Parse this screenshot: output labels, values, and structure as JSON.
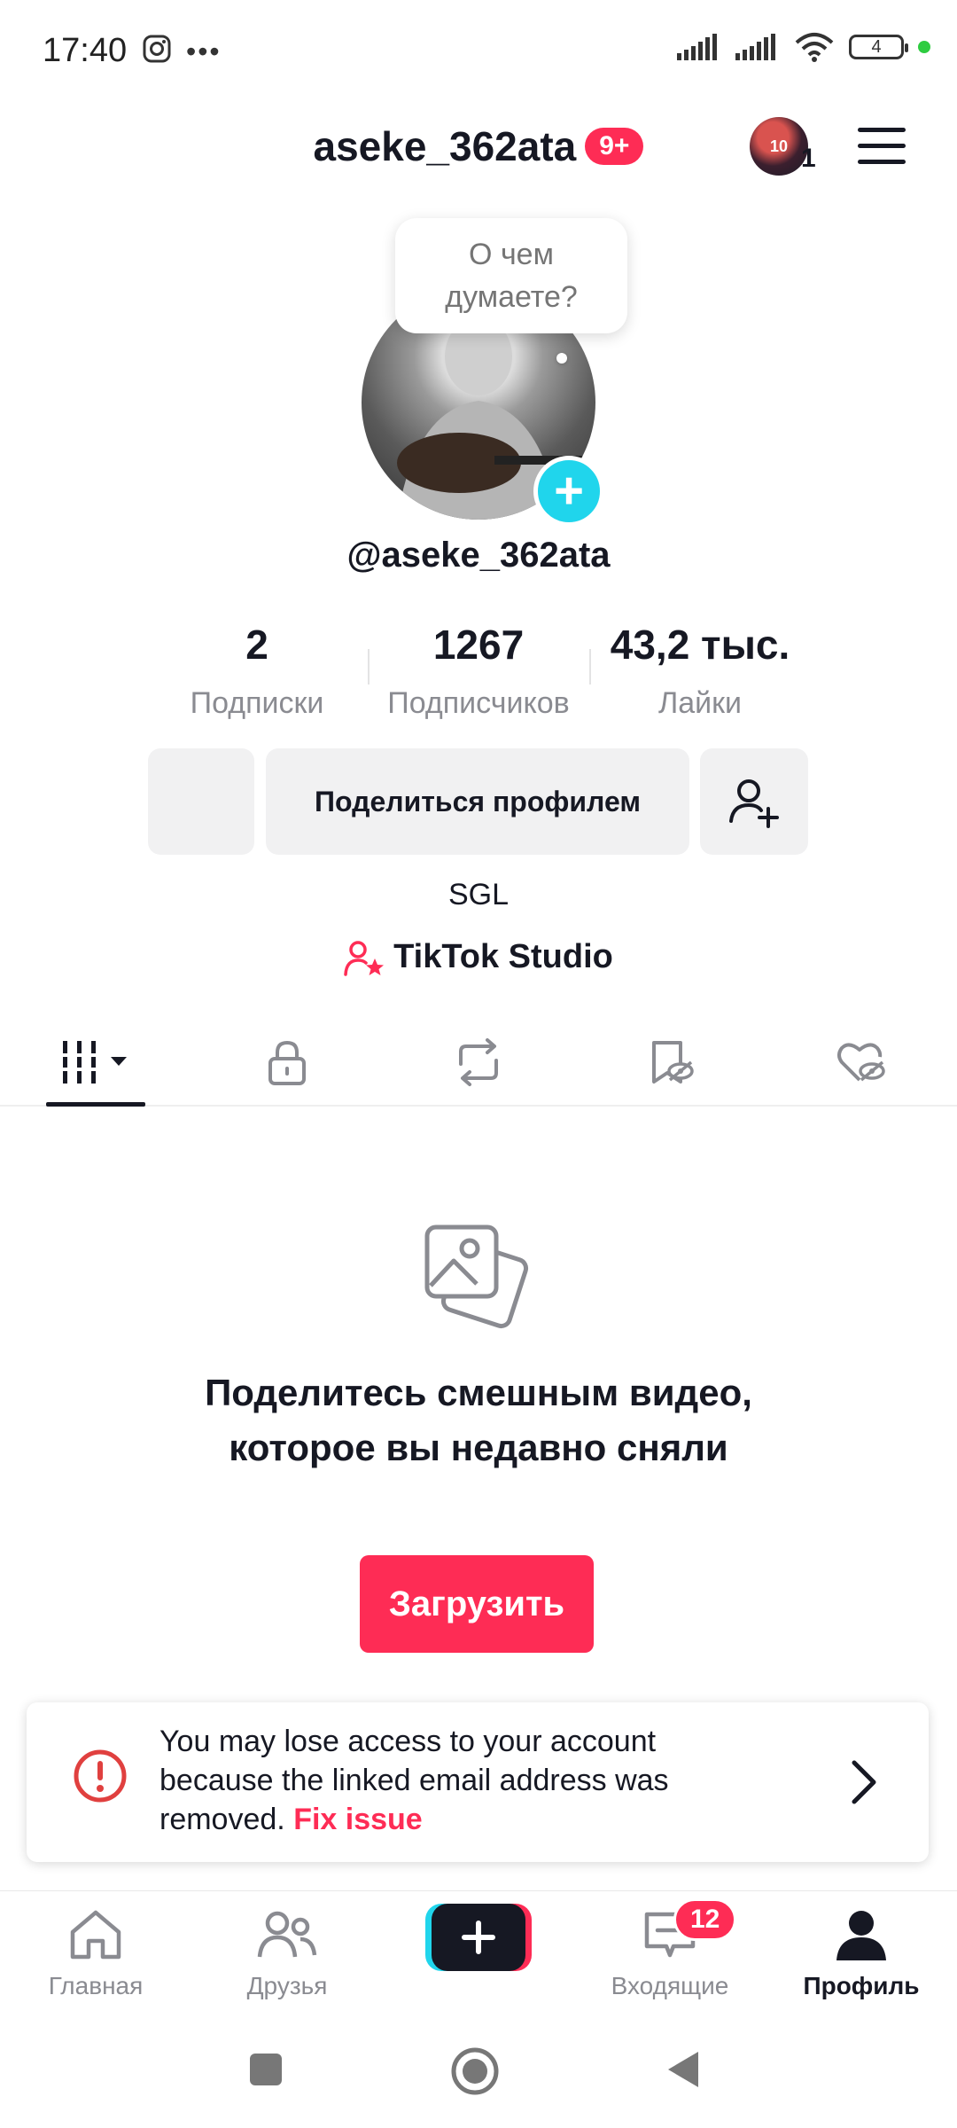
{
  "status_bar": {
    "time": "17:40",
    "battery": "4"
  },
  "header": {
    "username": "aseke_362ata",
    "notification_badge": "9+",
    "account_badge_number": "1",
    "avatar_text": "10"
  },
  "profile": {
    "thought_bubble": "О чем думаете?",
    "handle": "@aseke_362ata",
    "stats": [
      {
        "value": "2",
        "label": "Подписки"
      },
      {
        "value": "1267",
        "label": "Подписчиков"
      },
      {
        "value": "43,2 тыс.",
        "label": "Лайки"
      }
    ],
    "share_button": "Поделиться профилем",
    "bio": "SGL",
    "studio_link": "TikTok Studio"
  },
  "empty_state": {
    "title": "Поделитесь смешным видео, которое вы недавно сняли",
    "upload_button": "Загрузить"
  },
  "alert": {
    "message": "You may lose access to your account because the linked email address was removed.",
    "link": "Fix issue"
  },
  "bottom_nav": {
    "home": "Главная",
    "friends": "Друзья",
    "inbox": "Входящие",
    "inbox_badge": "12",
    "profile": "Профиль"
  },
  "colors": {
    "accent": "#fe2c55",
    "cyan": "#20d5ec"
  }
}
